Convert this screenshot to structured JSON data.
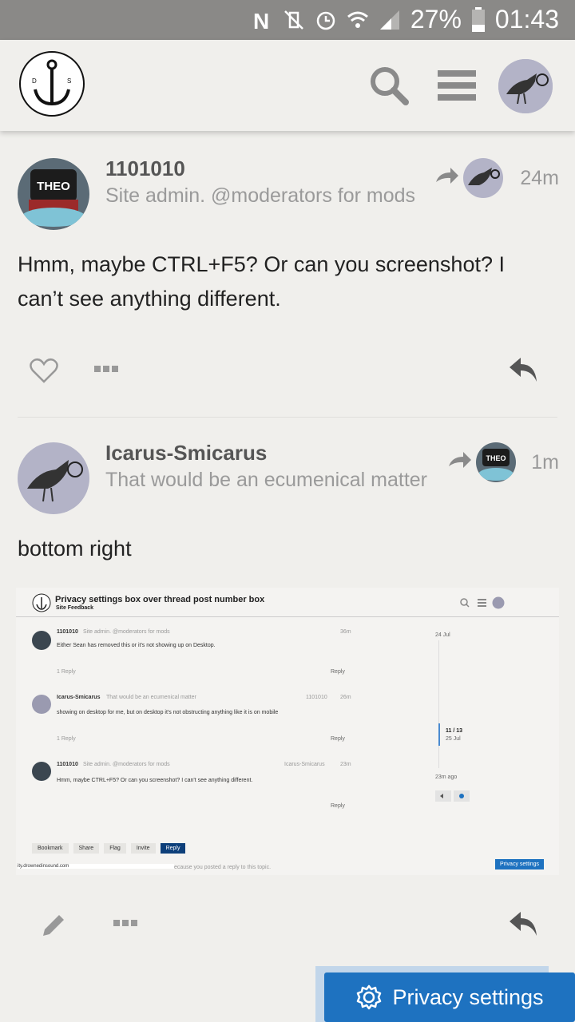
{
  "status_bar": {
    "battery": "27%",
    "time": "01:43"
  },
  "logo": {
    "letters": "D S"
  },
  "posts": [
    {
      "username": "1101010",
      "title": "Site admin. @moderators for mods",
      "age": "24m",
      "body": "Hmm, maybe CTRL+F5? Or can you screenshot? I can’t see anything different.",
      "avatar_text": "THEO"
    },
    {
      "username": "Icarus-Smicarus",
      "title": "That would be an ecumenical matter",
      "age": "1m",
      "body": "bottom right",
      "reply_avatar_text": "THEO"
    }
  ],
  "screenshot": {
    "topic_title": "Privacy settings box over thread post number box",
    "category": "Site Feedback",
    "posts": [
      {
        "user": "1101010",
        "title": "Site admin. @moderators for mods",
        "age": "36m",
        "text": "Either Sean has removed this or it's not showing up on Desktop.",
        "replies": "1 Reply",
        "reply": "Reply"
      },
      {
        "user": "Icarus-Smicarus",
        "title": "That would be an ecumenical matter",
        "reply_to": "1101010",
        "age": "26m",
        "text": "showing on desktop for me, but on desktop it's not obstructing anything like it is on mobile",
        "replies": "1 Reply",
        "reply": "Reply"
      },
      {
        "user": "1101010",
        "title": "Site admin. @moderators for mods",
        "reply_to": "Icarus-Smicarus",
        "age": "23m",
        "text": "Hmm, maybe CTRL+F5? Or can you screenshot? I can't see anything different.",
        "reply": "Reply"
      }
    ],
    "timeline": {
      "start": "24 Jul",
      "position": "11 / 13",
      "position_date": "25 Jul",
      "end": "23m ago"
    },
    "footer_buttons": [
      "Bookmark",
      "Share",
      "Flag",
      "Invite",
      "Reply"
    ],
    "url": "ity.drownedinsound.com",
    "notice": "ecause you posted a reply to this topic.",
    "privacy": "Privacy settings"
  },
  "privacy_button": {
    "label": "Privacy settings"
  },
  "colors": {
    "accent": "#1e72c0",
    "status_bar": "#8a8987",
    "background": "#f0efec"
  }
}
